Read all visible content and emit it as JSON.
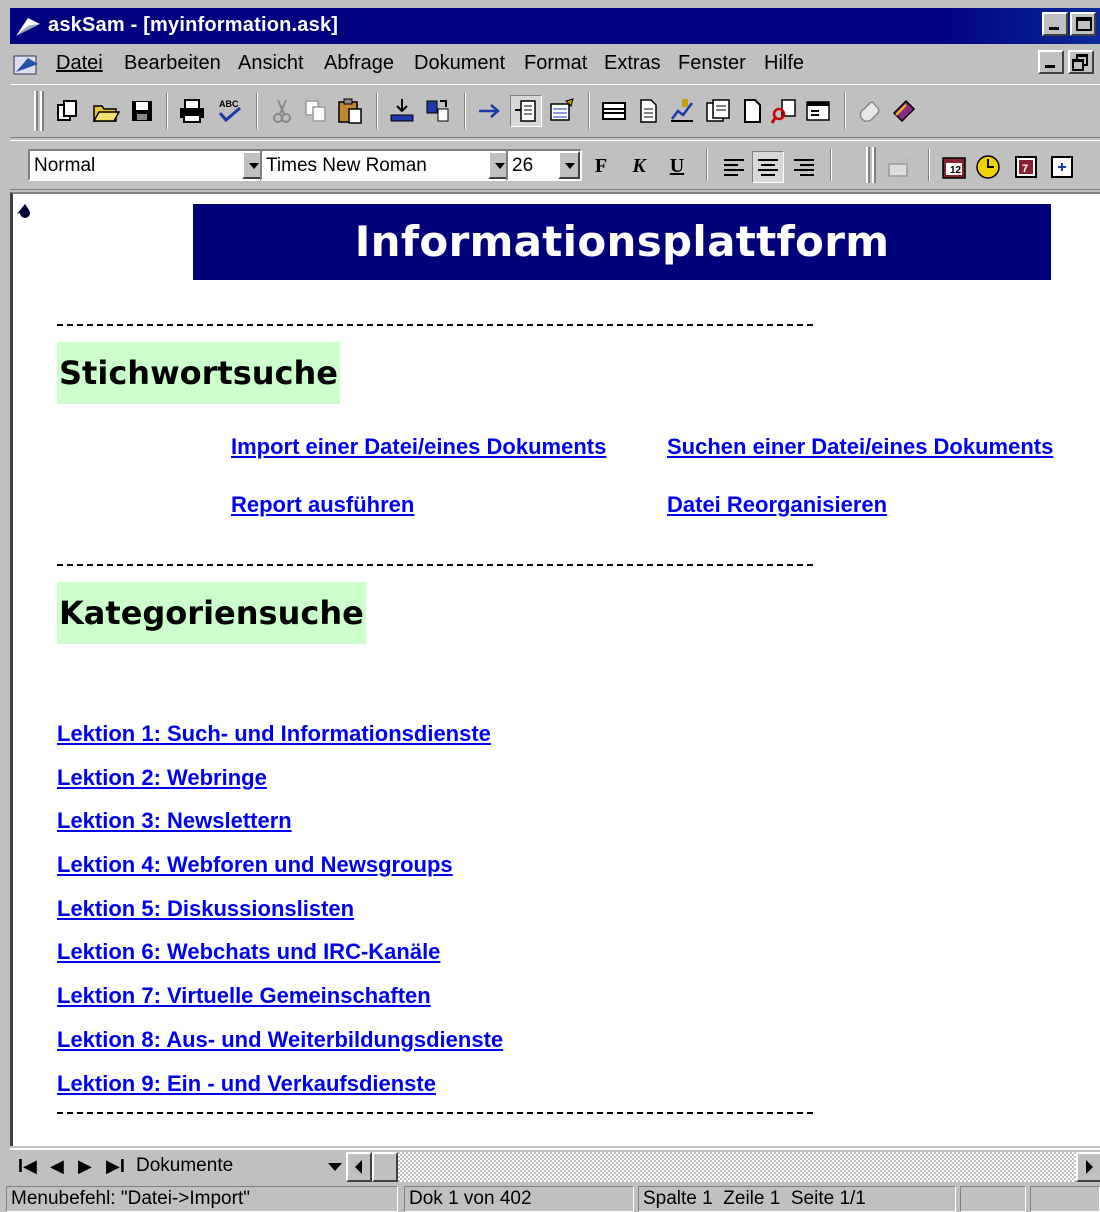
{
  "window": {
    "title": "askSam - [myinformation.ask]"
  },
  "menu": {
    "items": [
      {
        "label": "Datei"
      },
      {
        "label": "Bearbeiten"
      },
      {
        "label": "Ansicht"
      },
      {
        "label": "Abfrage"
      },
      {
        "label": "Dokument"
      },
      {
        "label": "Format"
      },
      {
        "label": "Extras"
      },
      {
        "label": "Fenster"
      },
      {
        "label": "Hilfe"
      }
    ]
  },
  "formatting": {
    "style": "Normal",
    "font": "Times New Roman",
    "size": "26",
    "bold_label": "F",
    "italic_label": "K",
    "underline_label": "U"
  },
  "document": {
    "banner": "Informationsplattform",
    "section1": {
      "heading": "Stichwortsuche",
      "links": [
        "Import einer Datei/eines Dokuments",
        "Suchen einer Datei/eines Dokuments",
        "Report ausführen",
        "Datei Reorganisieren"
      ]
    },
    "section2": {
      "heading": "Kategoriensuche",
      "lessons": [
        "Lektion 1: Such- und Informationsdienste",
        "Lektion 2: Webringe",
        "Lektion 3: Newslettern",
        "Lektion 4: Webforen und Newsgroups",
        "Lektion 5: Diskussionslisten",
        "Lektion 6: Webchats und IRC-Kanäle",
        "Lektion 7: Virtuelle Gemeinschaften",
        "Lektion 8: Aus- und Weiterbildungsdienste",
        "Lektion 9: Ein - und Verkaufsdienste"
      ]
    }
  },
  "navigator": {
    "first": "I◀",
    "prev": "◀",
    "next": "▶",
    "last": "▶I",
    "view": "Dokumente"
  },
  "status": {
    "message": "Menubefehl: \"Datei->Import\"",
    "doc_position": "Dok 1 von 402",
    "cursor": "Spalte 1  Zeile 1  Seite 1/1"
  },
  "colors": {
    "titlebar": "#000080",
    "banner": "#00007a",
    "heading_bg": "#ccffcc",
    "link": "#0000ee"
  }
}
